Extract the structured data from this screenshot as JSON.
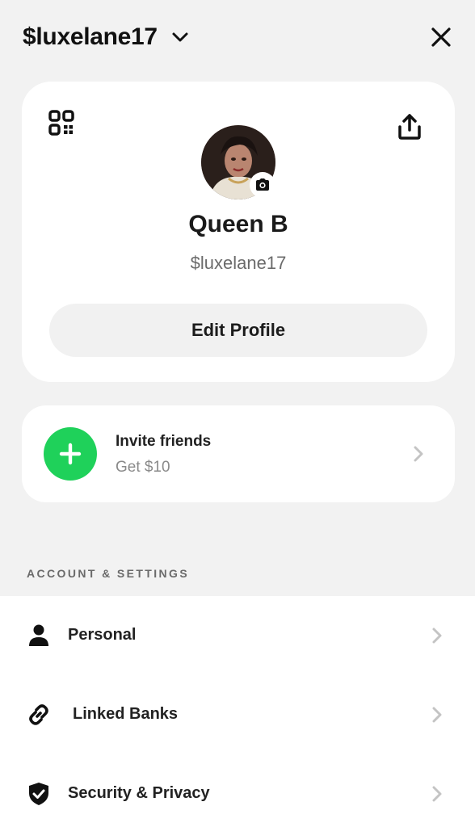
{
  "header": {
    "handle": "$luxelane17"
  },
  "profile": {
    "name": "Queen B",
    "cashtag": "$luxelane17",
    "edit_label": "Edit Profile"
  },
  "invite": {
    "title": "Invite friends",
    "subtitle": "Get $10"
  },
  "section": {
    "title": "ACCOUNT & SETTINGS"
  },
  "settings": {
    "items": [
      {
        "label": "Personal",
        "icon": "person-icon"
      },
      {
        "label": "Linked Banks",
        "icon": "link-icon"
      },
      {
        "label": "Security & Privacy",
        "icon": "shield-check-icon"
      }
    ]
  },
  "colors": {
    "background": "#f2f2f2",
    "card": "#ffffff",
    "accent_green": "#1fd15a",
    "button_gray": "#f1f1f1",
    "text_primary": "#1c1c1c",
    "text_secondary": "#6b6b6b"
  }
}
